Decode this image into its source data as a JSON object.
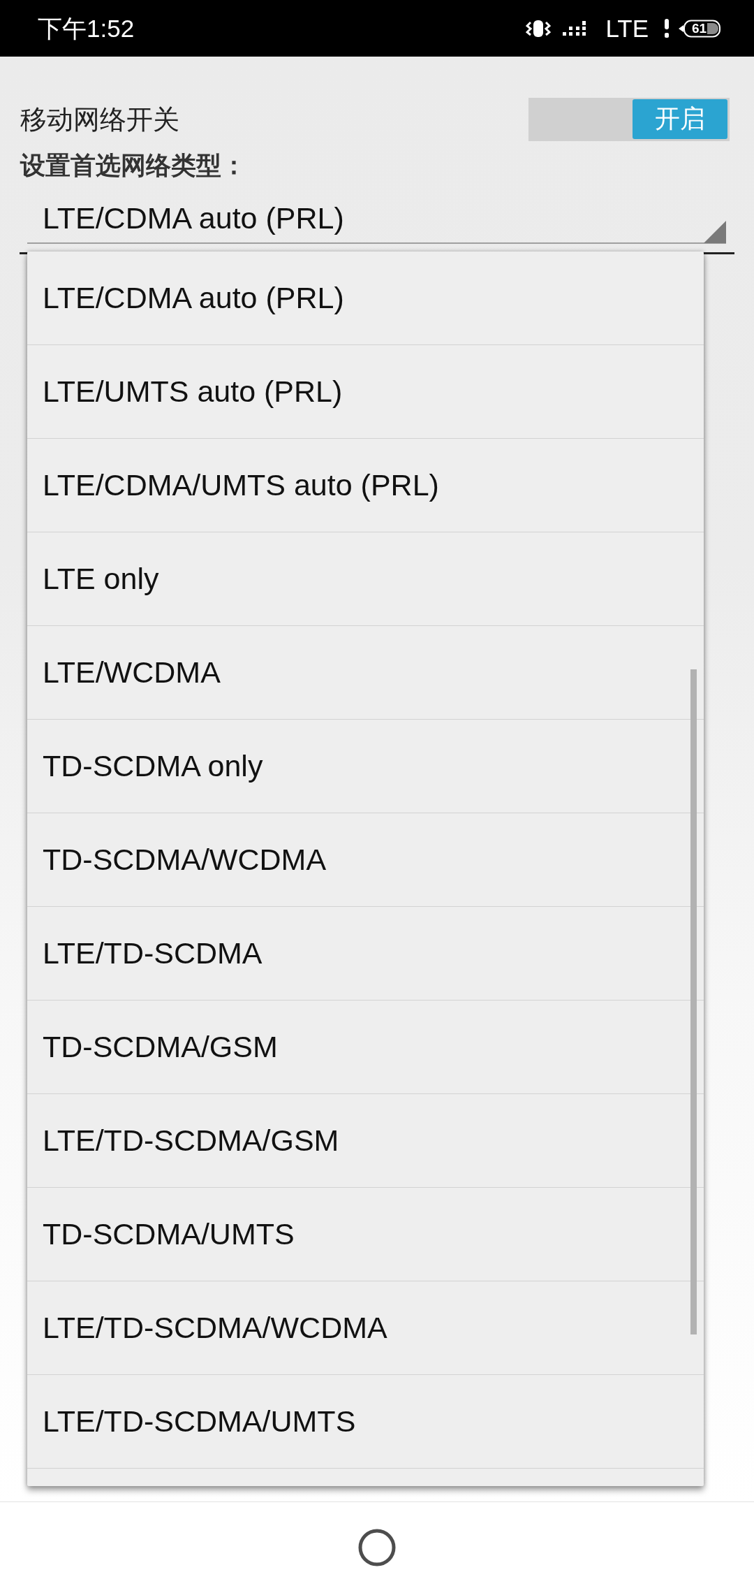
{
  "status_bar": {
    "time": "下午1:52",
    "network": "LTE",
    "battery": "61"
  },
  "settings": {
    "mobile_network": {
      "label": "移动网络开关",
      "switch_text": "开启",
      "on": true
    },
    "preferred_network": {
      "label": "设置首选网络类型：",
      "value": "LTE/CDMA auto (PRL)"
    }
  },
  "dropdown": {
    "options": [
      "LTE/CDMA auto (PRL)",
      "LTE/UMTS auto (PRL)",
      "LTE/CDMA/UMTS auto (PRL)",
      "LTE only",
      "LTE/WCDMA",
      "TD-SCDMA only",
      "TD-SCDMA/WCDMA",
      "LTE/TD-SCDMA",
      "TD-SCDMA/GSM",
      "LTE/TD-SCDMA/GSM",
      "TD-SCDMA/UMTS",
      "LTE/TD-SCDMA/WCDMA",
      "LTE/TD-SCDMA/UMTS"
    ]
  }
}
